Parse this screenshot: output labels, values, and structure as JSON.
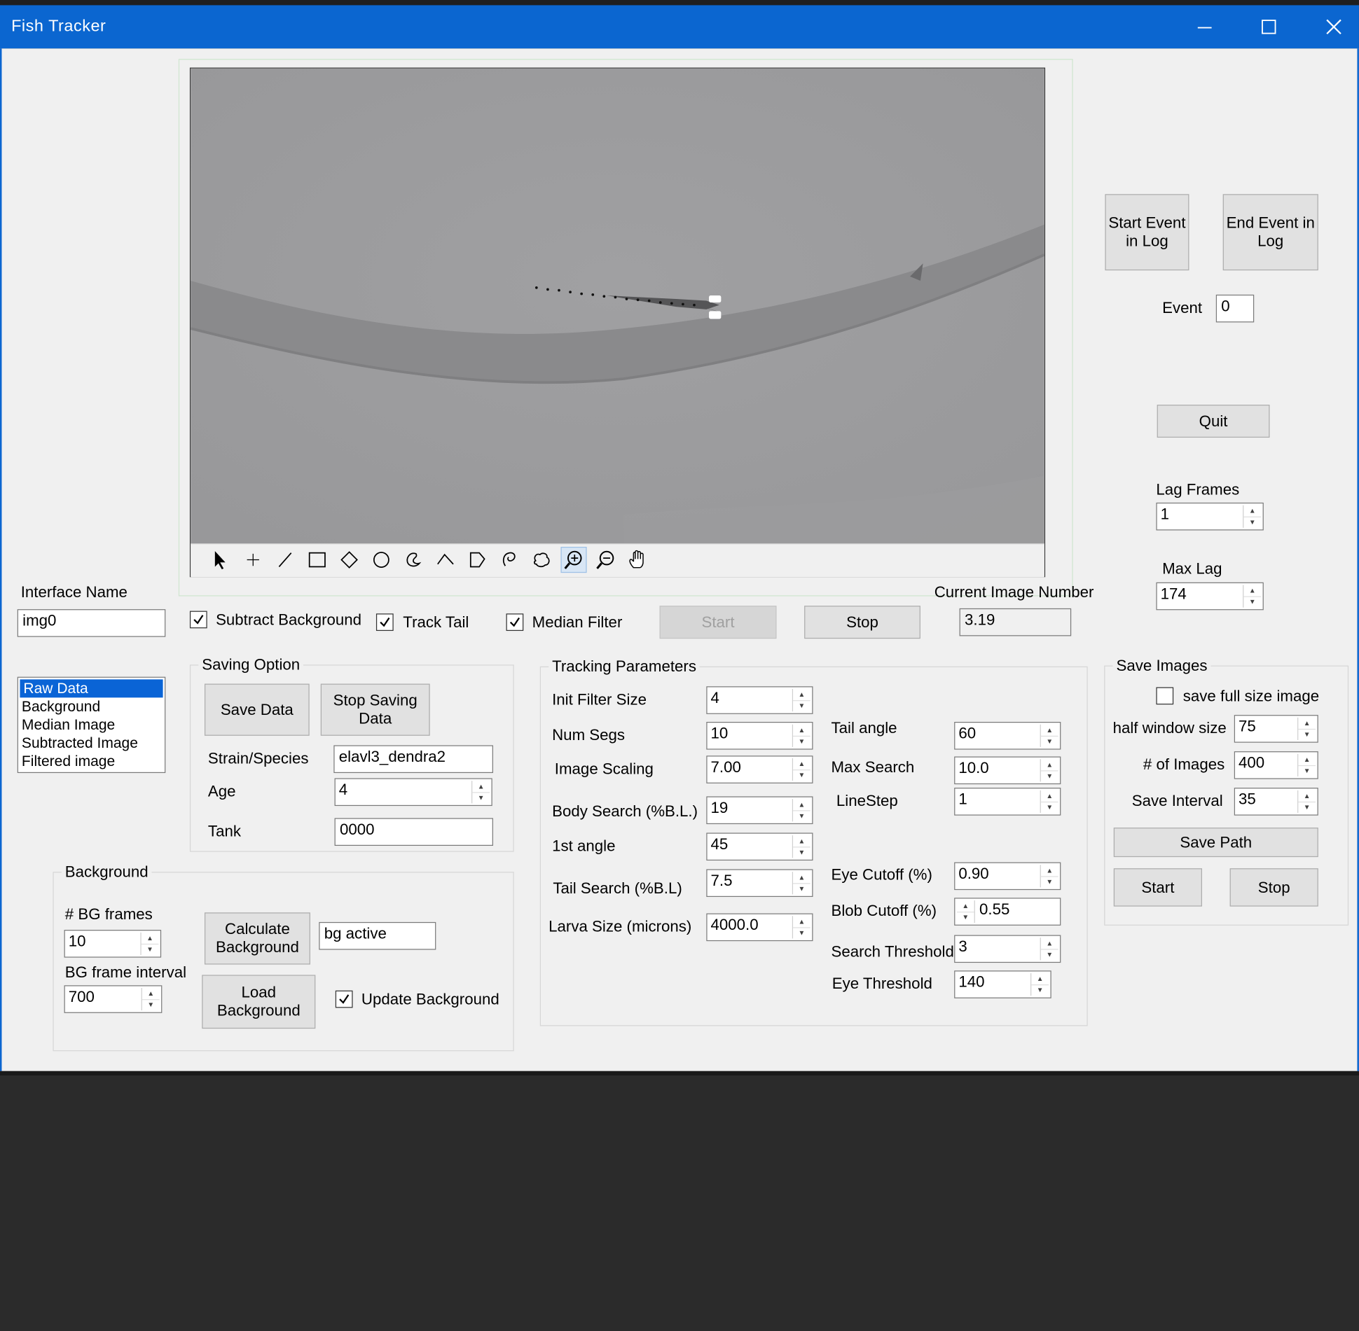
{
  "window": {
    "title": "Fish Tracker"
  },
  "controls": {
    "minimize": "—",
    "maximize": "☐",
    "close": "✕"
  },
  "top_buttons": {
    "start_event": "Start Event in Log",
    "end_event": "End Event in Log",
    "quit": "Quit"
  },
  "event": {
    "label": "Event",
    "value": "0"
  },
  "lag": {
    "lag_label": "Lag Frames",
    "lag_value": "1",
    "max_label": "Max Lag",
    "max_value": "174"
  },
  "interface": {
    "label": "Interface Name",
    "value": "img0"
  },
  "options": {
    "subtract_bg": "Subtract Background",
    "track_tail": "Track Tail",
    "median_filter": "Median Filter"
  },
  "run": {
    "start": "Start",
    "stop": "Stop"
  },
  "current_image": {
    "label": "Current Image Number",
    "value": "3.19"
  },
  "display_list": [
    "Raw Data",
    "Background",
    "Median Image",
    "Subtracted Image",
    "Filtered image"
  ],
  "saving": {
    "title": "Saving Option",
    "save_data": "Save Data",
    "stop_saving": "Stop Saving Data",
    "strain_label": "Strain/Species",
    "strain_value": "elavl3_dendra2",
    "age_label": "Age",
    "age_value": "4",
    "tank_label": "Tank",
    "tank_value": "0000"
  },
  "background": {
    "title": "Background",
    "frames_label": "# BG frames",
    "frames_value": "10",
    "interval_label": "BG frame interval",
    "interval_value": "700",
    "calculate": "Calculate Background",
    "status": "bg active",
    "load": "Load Background",
    "update": "Update Background"
  },
  "tracking": {
    "title": "Tracking Parameters",
    "init_filter_label": "Init Filter Size",
    "init_filter": "4",
    "num_segs_label": "Num Segs",
    "num_segs": "10",
    "image_scaling_label": "Image Scaling",
    "image_scaling": "7.00",
    "body_search_label": "Body Search  (%B.L.)",
    "body_search": "19",
    "first_angle_label": "1st angle",
    "first_angle": "45",
    "tail_search_label": "Tail Search (%B.L)",
    "tail_search": "7.5",
    "larva_size_label": "Larva Size (microns)",
    "larva_size": "4000.0",
    "tail_angle_label": "Tail angle",
    "tail_angle": "60",
    "max_search_label": "Max Search",
    "max_search": "10.0",
    "linestep_label": "LineStep",
    "linestep": "1",
    "eye_cutoff_label": "Eye Cutoff (%)",
    "eye_cutoff": "0.90",
    "blob_cutoff_label": "Blob Cutoff (%)",
    "blob_cutoff": "0.55",
    "search_threshold_label": "Search Threshold",
    "search_threshold": "3",
    "eye_threshold_label": "Eye Threshold",
    "eye_threshold": "140"
  },
  "save_images": {
    "title": "Save Images",
    "full_size_label": "save full size image",
    "half_window_label": "half window size",
    "half_window": "75",
    "num_images_label": "# of Images",
    "num_images": "400",
    "save_interval_label": "Save Interval",
    "save_interval": "35",
    "save_path": "Save Path",
    "start": "Start",
    "stop": "Stop"
  },
  "image_toolbar": [
    "arrow-icon",
    "crosshair-icon",
    "line-icon",
    "rectangle-icon",
    "diamond-icon",
    "circle-icon",
    "freehand-icon",
    "angle-icon",
    "polygon-icon",
    "lasso-icon",
    "blob-icon",
    "zoom-in-icon",
    "zoom-out-icon",
    "pan-icon"
  ]
}
